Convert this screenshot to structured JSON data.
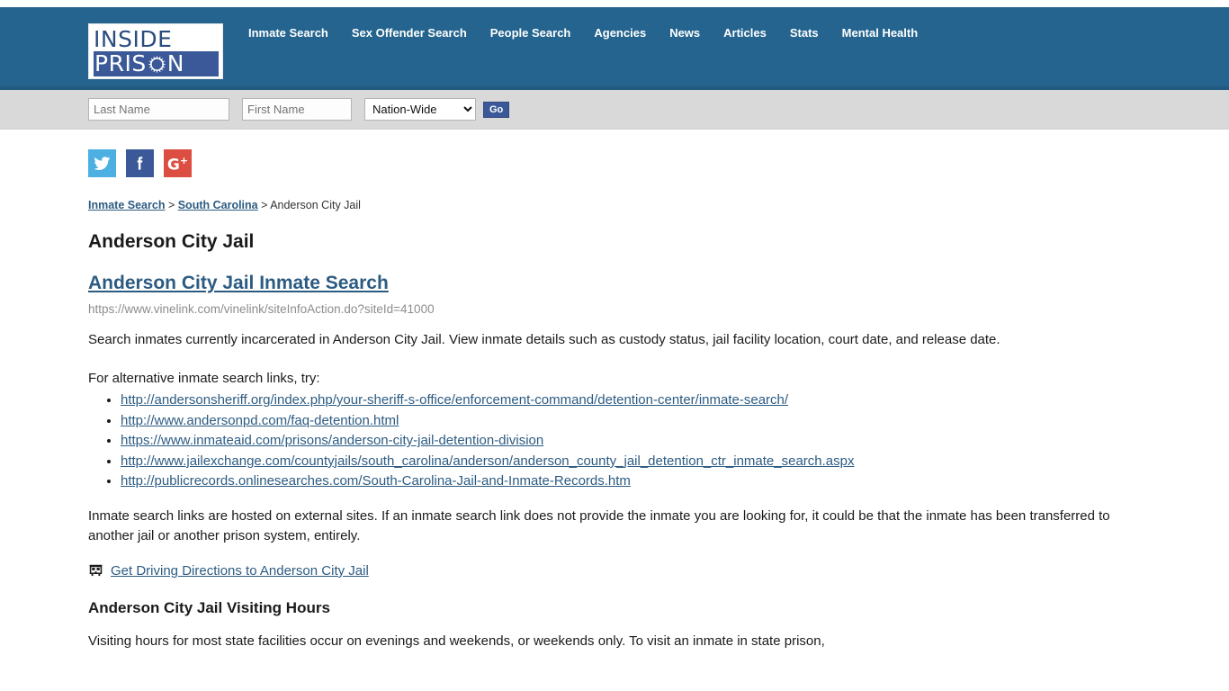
{
  "header": {
    "logo": {
      "line1": "INSIDE",
      "line2_before": "PRIS",
      "line2_after": "N",
      "icon": "barbed-wire-circle-icon"
    },
    "nav": [
      {
        "label": "Inmate Search"
      },
      {
        "label": "Sex Offender Search"
      },
      {
        "label": "People Search"
      },
      {
        "label": "Agencies"
      },
      {
        "label": "News"
      },
      {
        "label": "Articles"
      },
      {
        "label": "Stats"
      },
      {
        "label": "Mental Health"
      }
    ],
    "colors": {
      "header_bg": "#24648e",
      "logo_blue": "#3b5998",
      "searchbar_bg": "#d9d9d9"
    }
  },
  "search": {
    "last_name_placeholder": "Last Name",
    "last_name_value": "",
    "first_name_placeholder": "First Name",
    "first_name_value": "",
    "state_selected": "Nation-Wide",
    "state_options": [
      "Nation-Wide"
    ],
    "go_label": "Go"
  },
  "social": [
    {
      "name": "twitter",
      "label": "Twitter",
      "color": "#4cb0e3"
    },
    {
      "name": "facebook",
      "label": "Facebook",
      "color": "#3b5998"
    },
    {
      "name": "googleplus",
      "label": "Google Plus",
      "color": "#dc4e41"
    }
  ],
  "breadcrumb": {
    "item1": "Inmate Search",
    "sep1": " > ",
    "item2": "South Carolina",
    "sep2": " > ",
    "current": "Anderson City Jail"
  },
  "main": {
    "page_title": "Anderson City Jail",
    "search_link_heading": "Anderson City Jail Inmate Search",
    "search_link_url": "https://www.vinelink.com/vinelink/siteInfoAction.do?siteId=41000",
    "intro_paragraph": "Search inmates currently incarcerated in Anderson City Jail. View inmate details such as custody status, jail facility location, court date, and release date.",
    "alt_links_intro": "For alternative inmate search links, try:",
    "alt_links": [
      "http://andersonsheriff.org/index.php/your-sheriff-s-office/enforcement-command/detention-center/inmate-search/",
      "http://www.andersonpd.com/faq-detention.html",
      "https://www.inmateaid.com/prisons/anderson-city-jail-detention-division",
      "http://www.jailexchange.com/countyjails/south_carolina/anderson/anderson_county_jail_detention_ctr_inmate_search.aspx",
      "http://publicrecords.onlinesearches.com/South-Carolina-Jail-and-Inmate-Records.htm"
    ],
    "external_note": "Inmate search links are hosted on external sites. If an inmate search link does not provide the inmate you are looking for, it could be that the inmate has been transferred to another jail or another prison system, entirely.",
    "directions_link": "Get Driving Directions to Anderson City Jail",
    "directions_icon": "bus-icon",
    "visiting_hours_title": "Anderson City Jail Visiting Hours",
    "visiting_hours_paragraph": "Visiting hours for most state facilities occur on evenings and weekends, or weekends only. To visit an inmate in state prison,"
  }
}
